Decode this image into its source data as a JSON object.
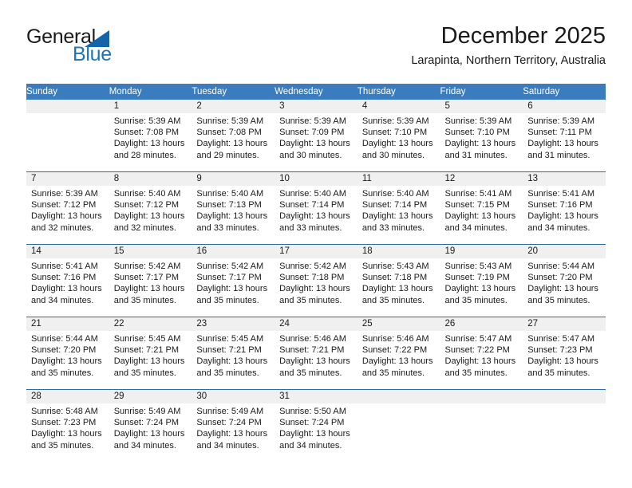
{
  "logo": {
    "word1": "General",
    "word2": "Blue",
    "triangle_icon": "triangle-icon",
    "color_dark": "#1a1a1a",
    "color_blue": "#1e74bb"
  },
  "header": {
    "title": "December 2025",
    "subtitle": "Larapinta, Northern Territory, Australia"
  },
  "theme": {
    "header_row_bg": "#3a7cbe",
    "header_row_text": "#ffffff",
    "row_divider": "#2c6ca8",
    "daynum_bg": "#f0f0f0",
    "cell_bg": "#ffffff"
  },
  "weekday_headers": [
    "Sunday",
    "Monday",
    "Tuesday",
    "Wednesday",
    "Thursday",
    "Friday",
    "Saturday"
  ],
  "weeks": [
    [
      {
        "day": "",
        "sunrise": "",
        "sunset": "",
        "daylight_line1": "",
        "daylight_line2": ""
      },
      {
        "day": "1",
        "sunrise": "Sunrise: 5:39 AM",
        "sunset": "Sunset: 7:08 PM",
        "daylight_line1": "Daylight: 13 hours",
        "daylight_line2": "and 28 minutes."
      },
      {
        "day": "2",
        "sunrise": "Sunrise: 5:39 AM",
        "sunset": "Sunset: 7:08 PM",
        "daylight_line1": "Daylight: 13 hours",
        "daylight_line2": "and 29 minutes."
      },
      {
        "day": "3",
        "sunrise": "Sunrise: 5:39 AM",
        "sunset": "Sunset: 7:09 PM",
        "daylight_line1": "Daylight: 13 hours",
        "daylight_line2": "and 30 minutes."
      },
      {
        "day": "4",
        "sunrise": "Sunrise: 5:39 AM",
        "sunset": "Sunset: 7:10 PM",
        "daylight_line1": "Daylight: 13 hours",
        "daylight_line2": "and 30 minutes."
      },
      {
        "day": "5",
        "sunrise": "Sunrise: 5:39 AM",
        "sunset": "Sunset: 7:10 PM",
        "daylight_line1": "Daylight: 13 hours",
        "daylight_line2": "and 31 minutes."
      },
      {
        "day": "6",
        "sunrise": "Sunrise: 5:39 AM",
        "sunset": "Sunset: 7:11 PM",
        "daylight_line1": "Daylight: 13 hours",
        "daylight_line2": "and 31 minutes."
      }
    ],
    [
      {
        "day": "7",
        "sunrise": "Sunrise: 5:39 AM",
        "sunset": "Sunset: 7:12 PM",
        "daylight_line1": "Daylight: 13 hours",
        "daylight_line2": "and 32 minutes."
      },
      {
        "day": "8",
        "sunrise": "Sunrise: 5:40 AM",
        "sunset": "Sunset: 7:12 PM",
        "daylight_line1": "Daylight: 13 hours",
        "daylight_line2": "and 32 minutes."
      },
      {
        "day": "9",
        "sunrise": "Sunrise: 5:40 AM",
        "sunset": "Sunset: 7:13 PM",
        "daylight_line1": "Daylight: 13 hours",
        "daylight_line2": "and 33 minutes."
      },
      {
        "day": "10",
        "sunrise": "Sunrise: 5:40 AM",
        "sunset": "Sunset: 7:14 PM",
        "daylight_line1": "Daylight: 13 hours",
        "daylight_line2": "and 33 minutes."
      },
      {
        "day": "11",
        "sunrise": "Sunrise: 5:40 AM",
        "sunset": "Sunset: 7:14 PM",
        "daylight_line1": "Daylight: 13 hours",
        "daylight_line2": "and 33 minutes."
      },
      {
        "day": "12",
        "sunrise": "Sunrise: 5:41 AM",
        "sunset": "Sunset: 7:15 PM",
        "daylight_line1": "Daylight: 13 hours",
        "daylight_line2": "and 34 minutes."
      },
      {
        "day": "13",
        "sunrise": "Sunrise: 5:41 AM",
        "sunset": "Sunset: 7:16 PM",
        "daylight_line1": "Daylight: 13 hours",
        "daylight_line2": "and 34 minutes."
      }
    ],
    [
      {
        "day": "14",
        "sunrise": "Sunrise: 5:41 AM",
        "sunset": "Sunset: 7:16 PM",
        "daylight_line1": "Daylight: 13 hours",
        "daylight_line2": "and 34 minutes."
      },
      {
        "day": "15",
        "sunrise": "Sunrise: 5:42 AM",
        "sunset": "Sunset: 7:17 PM",
        "daylight_line1": "Daylight: 13 hours",
        "daylight_line2": "and 35 minutes."
      },
      {
        "day": "16",
        "sunrise": "Sunrise: 5:42 AM",
        "sunset": "Sunset: 7:17 PM",
        "daylight_line1": "Daylight: 13 hours",
        "daylight_line2": "and 35 minutes."
      },
      {
        "day": "17",
        "sunrise": "Sunrise: 5:42 AM",
        "sunset": "Sunset: 7:18 PM",
        "daylight_line1": "Daylight: 13 hours",
        "daylight_line2": "and 35 minutes."
      },
      {
        "day": "18",
        "sunrise": "Sunrise: 5:43 AM",
        "sunset": "Sunset: 7:18 PM",
        "daylight_line1": "Daylight: 13 hours",
        "daylight_line2": "and 35 minutes."
      },
      {
        "day": "19",
        "sunrise": "Sunrise: 5:43 AM",
        "sunset": "Sunset: 7:19 PM",
        "daylight_line1": "Daylight: 13 hours",
        "daylight_line2": "and 35 minutes."
      },
      {
        "day": "20",
        "sunrise": "Sunrise: 5:44 AM",
        "sunset": "Sunset: 7:20 PM",
        "daylight_line1": "Daylight: 13 hours",
        "daylight_line2": "and 35 minutes."
      }
    ],
    [
      {
        "day": "21",
        "sunrise": "Sunrise: 5:44 AM",
        "sunset": "Sunset: 7:20 PM",
        "daylight_line1": "Daylight: 13 hours",
        "daylight_line2": "and 35 minutes."
      },
      {
        "day": "22",
        "sunrise": "Sunrise: 5:45 AM",
        "sunset": "Sunset: 7:21 PM",
        "daylight_line1": "Daylight: 13 hours",
        "daylight_line2": "and 35 minutes."
      },
      {
        "day": "23",
        "sunrise": "Sunrise: 5:45 AM",
        "sunset": "Sunset: 7:21 PM",
        "daylight_line1": "Daylight: 13 hours",
        "daylight_line2": "and 35 minutes."
      },
      {
        "day": "24",
        "sunrise": "Sunrise: 5:46 AM",
        "sunset": "Sunset: 7:21 PM",
        "daylight_line1": "Daylight: 13 hours",
        "daylight_line2": "and 35 minutes."
      },
      {
        "day": "25",
        "sunrise": "Sunrise: 5:46 AM",
        "sunset": "Sunset: 7:22 PM",
        "daylight_line1": "Daylight: 13 hours",
        "daylight_line2": "and 35 minutes."
      },
      {
        "day": "26",
        "sunrise": "Sunrise: 5:47 AM",
        "sunset": "Sunset: 7:22 PM",
        "daylight_line1": "Daylight: 13 hours",
        "daylight_line2": "and 35 minutes."
      },
      {
        "day": "27",
        "sunrise": "Sunrise: 5:47 AM",
        "sunset": "Sunset: 7:23 PM",
        "daylight_line1": "Daylight: 13 hours",
        "daylight_line2": "and 35 minutes."
      }
    ],
    [
      {
        "day": "28",
        "sunrise": "Sunrise: 5:48 AM",
        "sunset": "Sunset: 7:23 PM",
        "daylight_line1": "Daylight: 13 hours",
        "daylight_line2": "and 35 minutes."
      },
      {
        "day": "29",
        "sunrise": "Sunrise: 5:49 AM",
        "sunset": "Sunset: 7:24 PM",
        "daylight_line1": "Daylight: 13 hours",
        "daylight_line2": "and 34 minutes."
      },
      {
        "day": "30",
        "sunrise": "Sunrise: 5:49 AM",
        "sunset": "Sunset: 7:24 PM",
        "daylight_line1": "Daylight: 13 hours",
        "daylight_line2": "and 34 minutes."
      },
      {
        "day": "31",
        "sunrise": "Sunrise: 5:50 AM",
        "sunset": "Sunset: 7:24 PM",
        "daylight_line1": "Daylight: 13 hours",
        "daylight_line2": "and 34 minutes."
      },
      {
        "day": "",
        "sunrise": "",
        "sunset": "",
        "daylight_line1": "",
        "daylight_line2": ""
      },
      {
        "day": "",
        "sunrise": "",
        "sunset": "",
        "daylight_line1": "",
        "daylight_line2": ""
      },
      {
        "day": "",
        "sunrise": "",
        "sunset": "",
        "daylight_line1": "",
        "daylight_line2": ""
      }
    ]
  ]
}
